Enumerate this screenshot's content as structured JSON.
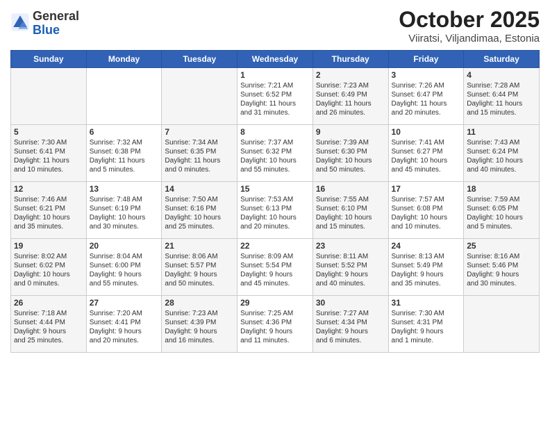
{
  "header": {
    "logo": {
      "general": "General",
      "blue": "Blue"
    },
    "title": "October 2025",
    "subtitle": "Viiratsi, Viljandimaa, Estonia"
  },
  "weekdays": [
    "Sunday",
    "Monday",
    "Tuesday",
    "Wednesday",
    "Thursday",
    "Friday",
    "Saturday"
  ],
  "weeks": [
    [
      {
        "day": "",
        "info": ""
      },
      {
        "day": "",
        "info": ""
      },
      {
        "day": "",
        "info": ""
      },
      {
        "day": "1",
        "info": "Sunrise: 7:21 AM\nSunset: 6:52 PM\nDaylight: 11 hours\nand 31 minutes."
      },
      {
        "day": "2",
        "info": "Sunrise: 7:23 AM\nSunset: 6:49 PM\nDaylight: 11 hours\nand 26 minutes."
      },
      {
        "day": "3",
        "info": "Sunrise: 7:26 AM\nSunset: 6:47 PM\nDaylight: 11 hours\nand 20 minutes."
      },
      {
        "day": "4",
        "info": "Sunrise: 7:28 AM\nSunset: 6:44 PM\nDaylight: 11 hours\nand 15 minutes."
      }
    ],
    [
      {
        "day": "5",
        "info": "Sunrise: 7:30 AM\nSunset: 6:41 PM\nDaylight: 11 hours\nand 10 minutes."
      },
      {
        "day": "6",
        "info": "Sunrise: 7:32 AM\nSunset: 6:38 PM\nDaylight: 11 hours\nand 5 minutes."
      },
      {
        "day": "7",
        "info": "Sunrise: 7:34 AM\nSunset: 6:35 PM\nDaylight: 11 hours\nand 0 minutes."
      },
      {
        "day": "8",
        "info": "Sunrise: 7:37 AM\nSunset: 6:32 PM\nDaylight: 10 hours\nand 55 minutes."
      },
      {
        "day": "9",
        "info": "Sunrise: 7:39 AM\nSunset: 6:30 PM\nDaylight: 10 hours\nand 50 minutes."
      },
      {
        "day": "10",
        "info": "Sunrise: 7:41 AM\nSunset: 6:27 PM\nDaylight: 10 hours\nand 45 minutes."
      },
      {
        "day": "11",
        "info": "Sunrise: 7:43 AM\nSunset: 6:24 PM\nDaylight: 10 hours\nand 40 minutes."
      }
    ],
    [
      {
        "day": "12",
        "info": "Sunrise: 7:46 AM\nSunset: 6:21 PM\nDaylight: 10 hours\nand 35 minutes."
      },
      {
        "day": "13",
        "info": "Sunrise: 7:48 AM\nSunset: 6:19 PM\nDaylight: 10 hours\nand 30 minutes."
      },
      {
        "day": "14",
        "info": "Sunrise: 7:50 AM\nSunset: 6:16 PM\nDaylight: 10 hours\nand 25 minutes."
      },
      {
        "day": "15",
        "info": "Sunrise: 7:53 AM\nSunset: 6:13 PM\nDaylight: 10 hours\nand 20 minutes."
      },
      {
        "day": "16",
        "info": "Sunrise: 7:55 AM\nSunset: 6:10 PM\nDaylight: 10 hours\nand 15 minutes."
      },
      {
        "day": "17",
        "info": "Sunrise: 7:57 AM\nSunset: 6:08 PM\nDaylight: 10 hours\nand 10 minutes."
      },
      {
        "day": "18",
        "info": "Sunrise: 7:59 AM\nSunset: 6:05 PM\nDaylight: 10 hours\nand 5 minutes."
      }
    ],
    [
      {
        "day": "19",
        "info": "Sunrise: 8:02 AM\nSunset: 6:02 PM\nDaylight: 10 hours\nand 0 minutes."
      },
      {
        "day": "20",
        "info": "Sunrise: 8:04 AM\nSunset: 6:00 PM\nDaylight: 9 hours\nand 55 minutes."
      },
      {
        "day": "21",
        "info": "Sunrise: 8:06 AM\nSunset: 5:57 PM\nDaylight: 9 hours\nand 50 minutes."
      },
      {
        "day": "22",
        "info": "Sunrise: 8:09 AM\nSunset: 5:54 PM\nDaylight: 9 hours\nand 45 minutes."
      },
      {
        "day": "23",
        "info": "Sunrise: 8:11 AM\nSunset: 5:52 PM\nDaylight: 9 hours\nand 40 minutes."
      },
      {
        "day": "24",
        "info": "Sunrise: 8:13 AM\nSunset: 5:49 PM\nDaylight: 9 hours\nand 35 minutes."
      },
      {
        "day": "25",
        "info": "Sunrise: 8:16 AM\nSunset: 5:46 PM\nDaylight: 9 hours\nand 30 minutes."
      }
    ],
    [
      {
        "day": "26",
        "info": "Sunrise: 7:18 AM\nSunset: 4:44 PM\nDaylight: 9 hours\nand 25 minutes."
      },
      {
        "day": "27",
        "info": "Sunrise: 7:20 AM\nSunset: 4:41 PM\nDaylight: 9 hours\nand 20 minutes."
      },
      {
        "day": "28",
        "info": "Sunrise: 7:23 AM\nSunset: 4:39 PM\nDaylight: 9 hours\nand 16 minutes."
      },
      {
        "day": "29",
        "info": "Sunrise: 7:25 AM\nSunset: 4:36 PM\nDaylight: 9 hours\nand 11 minutes."
      },
      {
        "day": "30",
        "info": "Sunrise: 7:27 AM\nSunset: 4:34 PM\nDaylight: 9 hours\nand 6 minutes."
      },
      {
        "day": "31",
        "info": "Sunrise: 7:30 AM\nSunset: 4:31 PM\nDaylight: 9 hours\nand 1 minute."
      },
      {
        "day": "",
        "info": ""
      }
    ]
  ]
}
